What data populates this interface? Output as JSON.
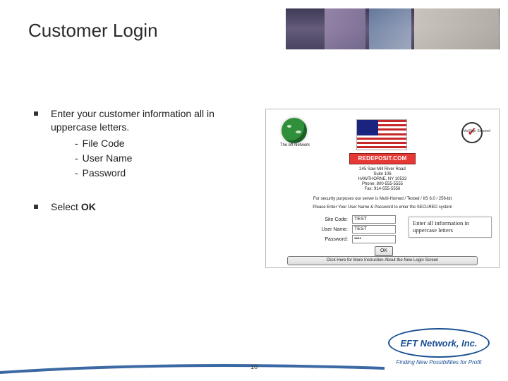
{
  "title": "Customer Login",
  "bullets": {
    "main": "Enter your customer information all in uppercase letters.",
    "subs": [
      "File Code",
      "User Name",
      "Password"
    ],
    "second": "Select",
    "second_bold": "OK"
  },
  "shot": {
    "globe_label": "The eft Network",
    "verisign_label": "VeriSign Secured",
    "brand": "REDEPOSIT.COM",
    "address": [
      "245 Saw Mill River Road",
      "Suite 106",
      "HAWTHORNE, NY 10532",
      "Phone: 800-555-5555",
      "Fax: 914-555-5556"
    ],
    "security_msg": "For security purposes our server is Multi-Homed / Tested / IIS 6.0 / 256-bit",
    "enter_msg": "Please Enter Your User Name & Password to enter the SECURED system",
    "fields": {
      "site_label": "Site Code:",
      "site_value": "TEST",
      "user_label": "User Name:",
      "user_value": "TEST",
      "pass_label": "Password:",
      "pass_value": "••••"
    },
    "ok": "OK",
    "callout": "Enter all information in uppercase letters",
    "instruct_btn": "Click Here for More Instruction About the New Login Screen"
  },
  "footer": {
    "page": "10",
    "logo_main": "EFT Network, Inc.",
    "tagline": "Finding New Possibilities for Profit"
  }
}
